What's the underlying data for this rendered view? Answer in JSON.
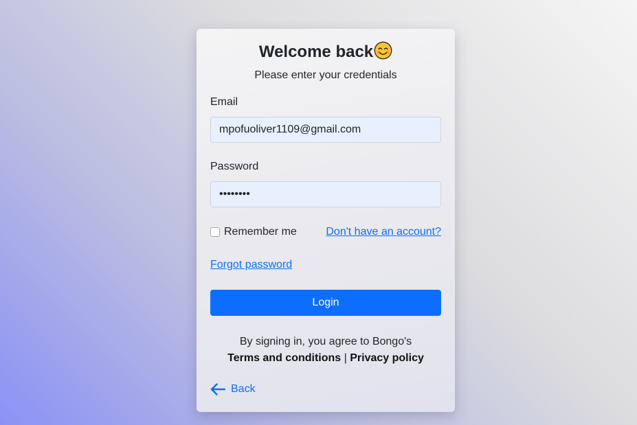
{
  "header": {
    "title": "Welcome back",
    "subtitle": "Please enter your credentials"
  },
  "form": {
    "email_label": "Email",
    "email_value": "mpofuoliver1109@gmail.com",
    "password_label": "Password",
    "password_value": "••••••••",
    "remember_label": "Remember me",
    "remember_checked": false,
    "signup_link": "Don't have an account?",
    "forgot_link": "Forgot password",
    "login_button": "Login"
  },
  "footer": {
    "agree_text": "By signing in, you agree to Bongo's",
    "terms_link": "Terms and conditions",
    "separator": "|",
    "privacy_link": "Privacy policy",
    "back_label": "Back"
  },
  "icons": {
    "title_emoji": "smiling-face-icon",
    "back": "arrow-left-icon"
  },
  "colors": {
    "accent": "#0d6efd",
    "input_bg": "#e8f0fe"
  }
}
